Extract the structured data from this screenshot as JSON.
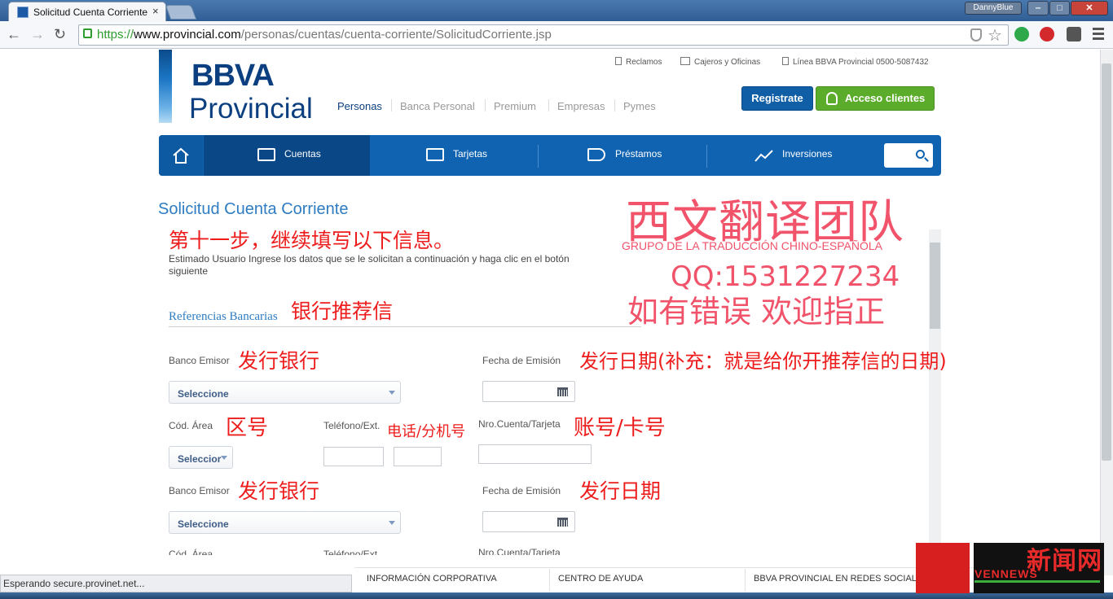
{
  "window": {
    "tab_title": "Solicitud Cuenta Corriente",
    "tab_close": "×",
    "user": "DannyBlue",
    "min": "‒",
    "max": "□",
    "close": "✕"
  },
  "toolbar": {
    "back": "←",
    "forward": "→",
    "reload": "↻",
    "url_scheme": "https://",
    "url_host": "www.provincial.com",
    "url_path": "/personas/cuentas/cuenta-corriente/SolicitudCorriente.jsp",
    "star": "☆"
  },
  "site": {
    "logo_top": "BBVA",
    "logo_bottom": "Provincial",
    "util_links": [
      "Reclamos",
      "Cajeros y Oficinas",
      "Línea BBVA Provincial 0500-5087432"
    ],
    "segments": [
      "Personas",
      "Banca Personal",
      "Premium",
      "Empresas",
      "Pymes"
    ],
    "registrate": "Registrate",
    "acceso": "Acceso clientes",
    "nav": [
      "Cuentas",
      "Tarjetas",
      "Préstamos",
      "Inversiones"
    ]
  },
  "form": {
    "page_title": "Solicitud Cuenta Corriente",
    "intro": "Estimado Usuario Ingrese los datos que se le solicitan a continuación y haga clic en el botón siguiente",
    "section_title": "Referencias Bancarias",
    "banco_emisor": "Banco Emisor",
    "fecha_emision": "Fecha de Emisión",
    "cod_area": "Cód. Área",
    "telefono": "Teléfono/Ext.",
    "nro_cuenta": "Nro.Cuenta/Tarjeta",
    "select_placeholder": "Seleccione",
    "select_short": "Seleccior",
    "cut_cod_area": "Cód. Área",
    "cut_telefono": "Teléfono/Ext.",
    "cut_nro_cuenta": "Nro.Cuenta/Tarjeta"
  },
  "annotations": {
    "step": "第十一步，继续填写以下信息。",
    "references": "银行推荐信",
    "issuing_bank": "发行银行",
    "issue_date_long": "发行日期(补充：就是给你开推荐信的日期)",
    "area_code": "区号",
    "phone": "电话/分机号",
    "account": "账号/卡号",
    "issuing_bank_2": "发行银行",
    "issue_date_short": "发行日期"
  },
  "watermark": {
    "team_cn": "西文翻译团队",
    "team_es": "GRUPO DE LA TRADUCCIÓN CHINO-ESPAÑOLA",
    "qq": "QQ:1531227234",
    "correction": "如有错误 欢迎指正"
  },
  "footer": {
    "items": [
      "INFORMACIÓN CORPORATIVA",
      "CENTRO DE AYUDA",
      "BBVA PROVINCIAL EN REDES SOCIALES"
    ],
    "status": "Esperando secure.provinet.net..."
  },
  "corner_logo": {
    "cn": "新闻网",
    "en": "VENNEWS"
  },
  "colors": {
    "brand_blue": "#0f63b1",
    "brand_dark": "#0b3f7f",
    "green": "#5cac2c",
    "note_red": "#ee1d1d",
    "watermark_pink": "#f0536a"
  }
}
